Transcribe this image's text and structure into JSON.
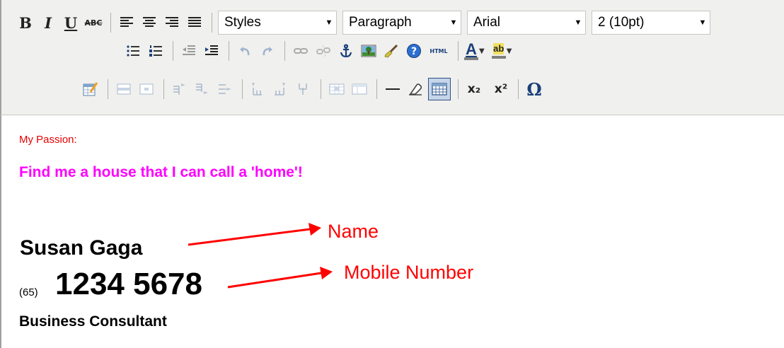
{
  "toolbar": {
    "formatting": {
      "bold_label": "B",
      "italic_label": "I",
      "underline_label": "U",
      "strike_label": "ABC"
    },
    "styles_select": {
      "selected": "Styles"
    },
    "format_select": {
      "selected": "Paragraph"
    },
    "font_select": {
      "selected": "Arial"
    },
    "size_select": {
      "selected": "2 (10pt)"
    },
    "html_button_label": "HTML",
    "text_color_label": "A",
    "highlight_label": "ab",
    "special_char_label": "Ω",
    "subscript_label": "x₂",
    "superscript_label": "x²",
    "icons": [
      "bold-icon",
      "italic-icon",
      "underline-icon",
      "strikethrough-icon",
      "align-left-icon",
      "align-center-icon",
      "align-right-icon",
      "align-justify-icon",
      "bullet-list-icon",
      "numbered-list-icon",
      "outdent-icon",
      "indent-icon",
      "undo-icon",
      "redo-icon",
      "link-icon",
      "unlink-icon",
      "anchor-icon",
      "image-icon",
      "cleanup-icon",
      "help-icon",
      "html-icon",
      "text-color-icon",
      "highlight-color-icon",
      "table-properties-icon",
      "row-properties-icon",
      "cell-properties-icon",
      "insert-row-before-icon",
      "insert-row-after-icon",
      "delete-row-icon",
      "insert-column-before-icon",
      "insert-column-after-icon",
      "delete-column-icon",
      "merge-cells-icon",
      "split-cell-icon",
      "horizontal-rule-icon",
      "remove-format-icon",
      "visual-aid-icon",
      "subscript-icon",
      "superscript-icon",
      "special-character-icon"
    ],
    "colors": {
      "toolbar_bg": "#f0f0ee",
      "text_color_swatch": "#7f7f7f",
      "highlight_swatch": "#7f7f7f"
    }
  },
  "content": {
    "passion_label": "My Passion:",
    "headline": "Find me a house that I can call a 'home'!",
    "name": "Susan Gaga",
    "country_code": "(65)",
    "phone": "1234 5678",
    "job_title": "Business Consultant",
    "colors": {
      "passion_label": "#e60000",
      "headline": "#ff00ff",
      "annotation": "#ff0000"
    }
  },
  "annotations": {
    "name_label": "Name",
    "mobile_label": "Mobile Number"
  }
}
